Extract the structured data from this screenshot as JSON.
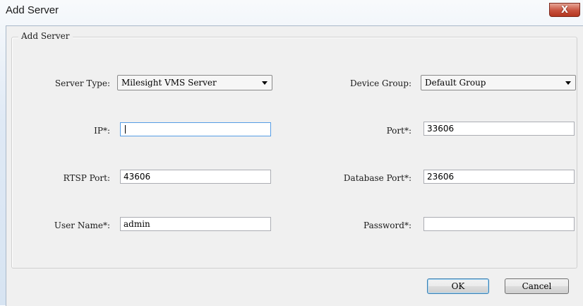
{
  "window": {
    "title": "Add Server",
    "close_glyph": "X"
  },
  "group": {
    "legend": "Add Server"
  },
  "form": {
    "server_type": {
      "label": "Server Type:",
      "value": "Milesight VMS Server"
    },
    "device_group": {
      "label": "Device Group:",
      "value": "Default Group"
    },
    "ip": {
      "label": "IP*:",
      "value": ""
    },
    "port": {
      "label": "Port*:",
      "value": "33606"
    },
    "rtsp_port": {
      "label": "RTSP Port:",
      "value": "43606"
    },
    "database_port": {
      "label": "Database Port*:",
      "value": "23606"
    },
    "user_name": {
      "label": "User Name*:",
      "value": "admin"
    },
    "password": {
      "label": "Password*:",
      "value": ""
    }
  },
  "buttons": {
    "ok": "OK",
    "cancel": "Cancel"
  },
  "icons": {
    "close": "close-icon",
    "dropdown": "chevron-down-icon"
  },
  "colors": {
    "close_button": "#c7513d",
    "focus_border": "#569de5",
    "default_button_border": "#3c7fb1"
  }
}
